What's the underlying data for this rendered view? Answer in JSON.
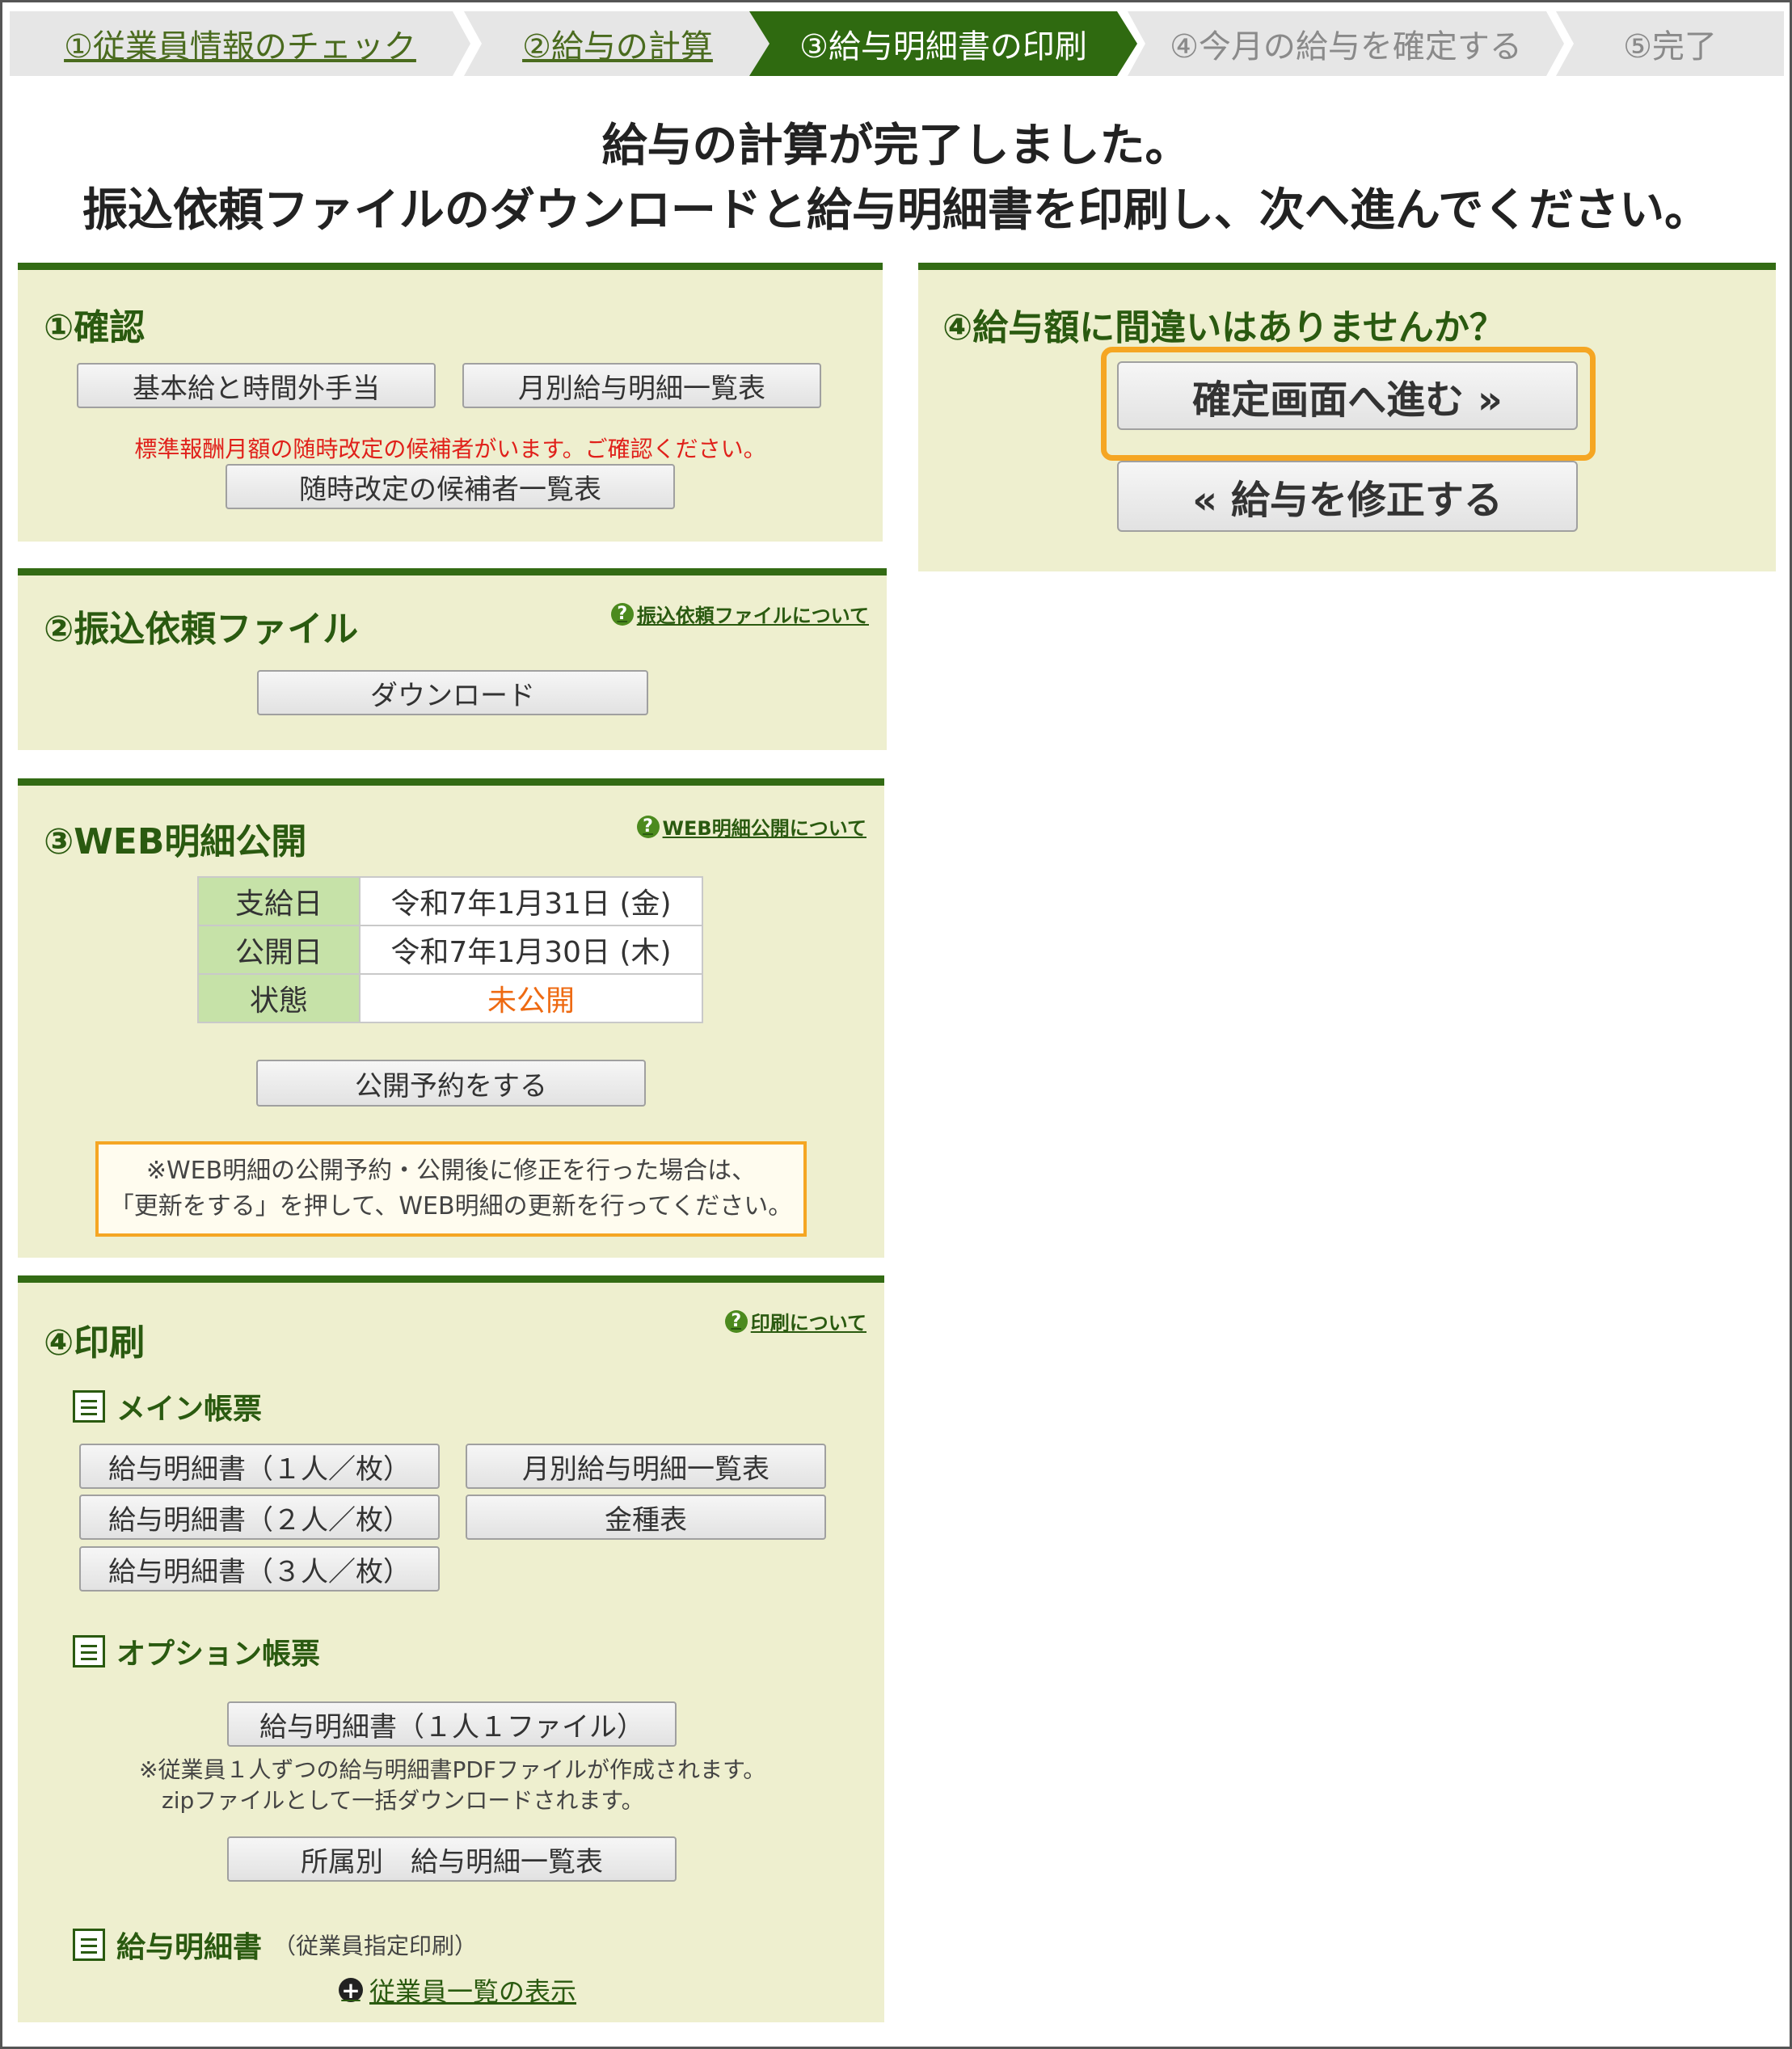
{
  "steps": [
    {
      "label": "①従業員情報のチェック"
    },
    {
      "label": "②給与の計算"
    },
    {
      "label": "③給与明細書の印刷"
    },
    {
      "label": "④今月の給与を確定する"
    },
    {
      "label": "⑤完了"
    }
  ],
  "heading": {
    "line1": "給与の計算が完了しました。",
    "line2": "振込依頼ファイルのダウンロードと給与明細書を印刷し、次へ進んでください。"
  },
  "confirm": {
    "title": "①確認",
    "btn_basic": "基本給と時間外手当",
    "btn_monthly": "月別給与明細一覧表",
    "warning": "標準報酬月額の随時改定の候補者がいます。ご確認ください。",
    "btn_candidates": "随時改定の候補者一覧表"
  },
  "transfer": {
    "title": "②振込依頼ファイル",
    "help": "振込依頼ファイルについて",
    "btn_download": "ダウンロード"
  },
  "web": {
    "title": "③WEB明細公開",
    "help": "WEB明細公開について",
    "rows": [
      {
        "key": "支給日",
        "value": "令和7年1月31日 (金)"
      },
      {
        "key": "公開日",
        "value": "令和7年1月30日 (木)"
      },
      {
        "key": "状態",
        "value": "未公開"
      }
    ],
    "btn_schedule": "公開予約をする",
    "note_line1": "※WEB明細の公開予約・公開後に修正を行った場合は、",
    "note_line2": "「更新をする」を押して、WEB明細の更新を行ってください。"
  },
  "print": {
    "title": "④印刷",
    "help": "印刷について",
    "main_label": "メイン帳票",
    "btn_p1": "給与明細書（１人／枚）",
    "btn_p2": "給与明細書（２人／枚）",
    "btn_p3": "給与明細書（３人／枚）",
    "btn_monthly": "月別給与明細一覧表",
    "btn_kinshu": "金種表",
    "option_label": "オプション帳票",
    "btn_onefile": "給与明細書（１人１ファイル）",
    "option_note1": "※従業員１人ずつの給与明細書PDFファイルが作成されます。",
    "option_note2": "zipファイルとして一括ダウンロードされます。",
    "btn_dept": "所属別　給与明細一覧表",
    "specify_label": "給与明細書",
    "specify_sub": "（従業員指定印刷）",
    "expander": "従業員一覧の表示"
  },
  "confirm_amount": {
    "title": "④給与額に間違いはありませんか？",
    "btn_next": "確定画面へ進む »",
    "btn_back": "« 給与を修正する"
  }
}
